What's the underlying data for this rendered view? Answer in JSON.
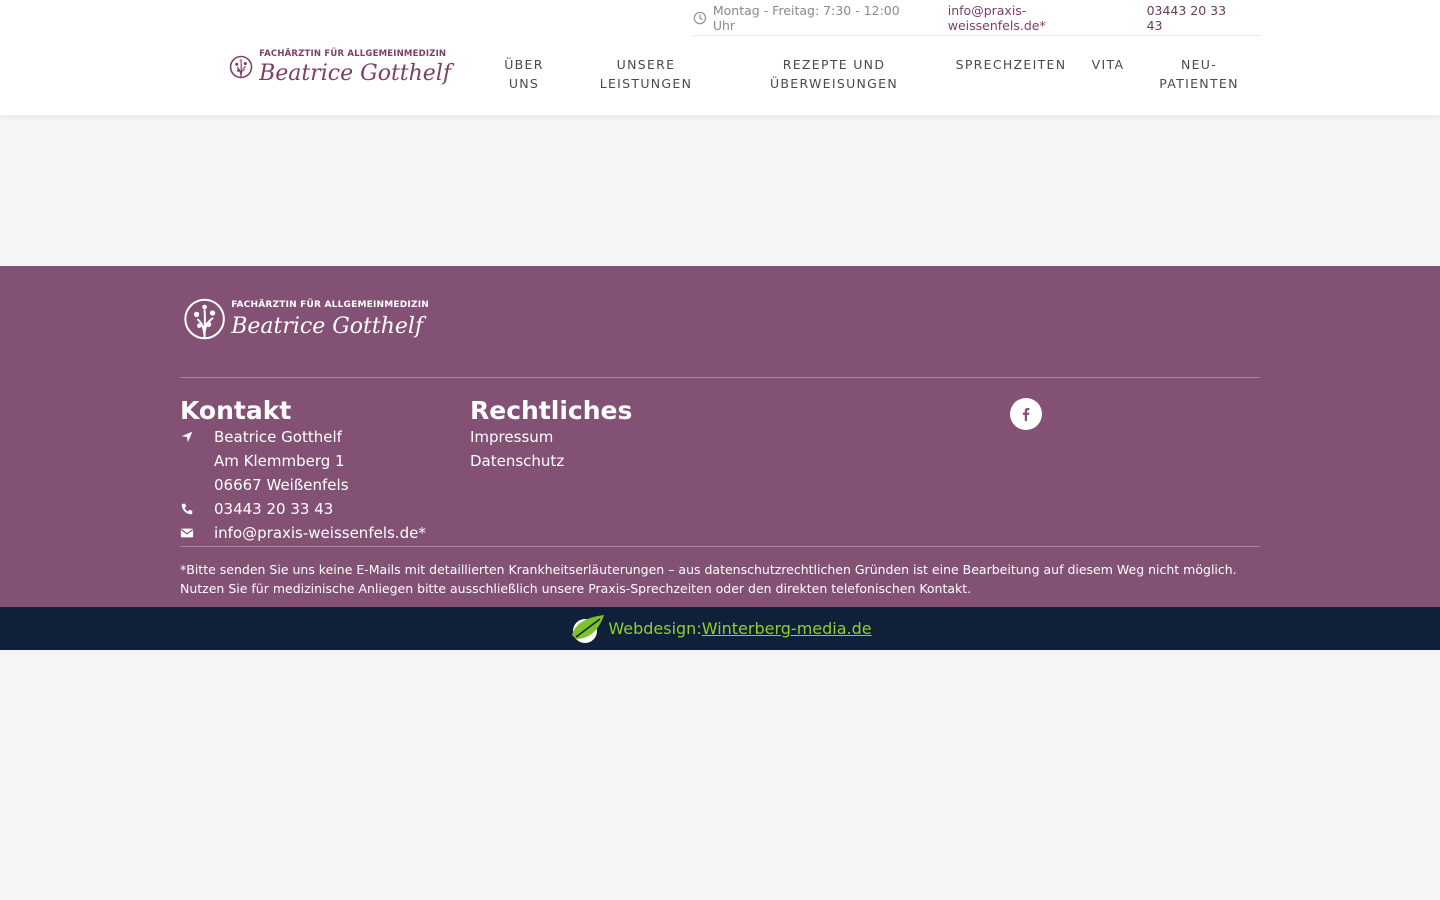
{
  "topbar": {
    "hours": "Montag - Freitag: 7:30 - 12:00 Uhr",
    "email": "info@praxis-weissenfels.de*",
    "phone": "03443 20 33 43"
  },
  "logo": {
    "subtitle": "FACHÄRZTIN FÜR ALLGEMEINMEDIZIN",
    "name": "Beatrice Gotthelf"
  },
  "nav": {
    "items": [
      {
        "line1": "ÜBER",
        "line2": "UNS"
      },
      {
        "line1": "UNSERE",
        "line2": "LEISTUNGEN"
      },
      {
        "line1": "REZEPTE UND",
        "line2": "ÜBERWEISUNGEN"
      },
      {
        "line1": "SPRECHZEITEN",
        "line2": ""
      },
      {
        "line1": "VITA",
        "line2": ""
      },
      {
        "line1": "NEU-",
        "line2": "PATIENTEN"
      }
    ]
  },
  "footer": {
    "logo_subtitle": "FACHÄRZTIN FÜR ALLGEMEINMEDIZIN",
    "logo_name": "Beatrice Gotthelf",
    "contact": {
      "title": "Kontakt",
      "name": "Beatrice Gotthelf",
      "street": "Am Klemmberg 1",
      "city": "06667 Weißenfels",
      "phone": "03443 20 33 43",
      "email": "info@praxis-weissenfels.de*"
    },
    "legal": {
      "title": "Rechtliches",
      "impressum": "Impressum",
      "datenschutz": "Datenschutz"
    },
    "disclaimer_line1": "*Bitte senden Sie uns keine E-Mails mit detaillierten Krankheitserläuterungen – aus datenschutzrechtlichen Gründen ist eine Bearbeitung auf diesem Weg nicht möglich.",
    "disclaimer_line2": "Nutzen Sie für medizinische Anliegen bitte ausschließlich unsere Praxis-Sprechzeiten oder den direkten telefonischen Kontakt."
  },
  "credit": {
    "label": "Webdesign:",
    "link": "Winterberg-media.de"
  },
  "colors": {
    "brand": "#7b3f68",
    "footer_bg": "#835174",
    "bottom_bg": "#0f2038",
    "credit_green": "#8fcf2e"
  }
}
